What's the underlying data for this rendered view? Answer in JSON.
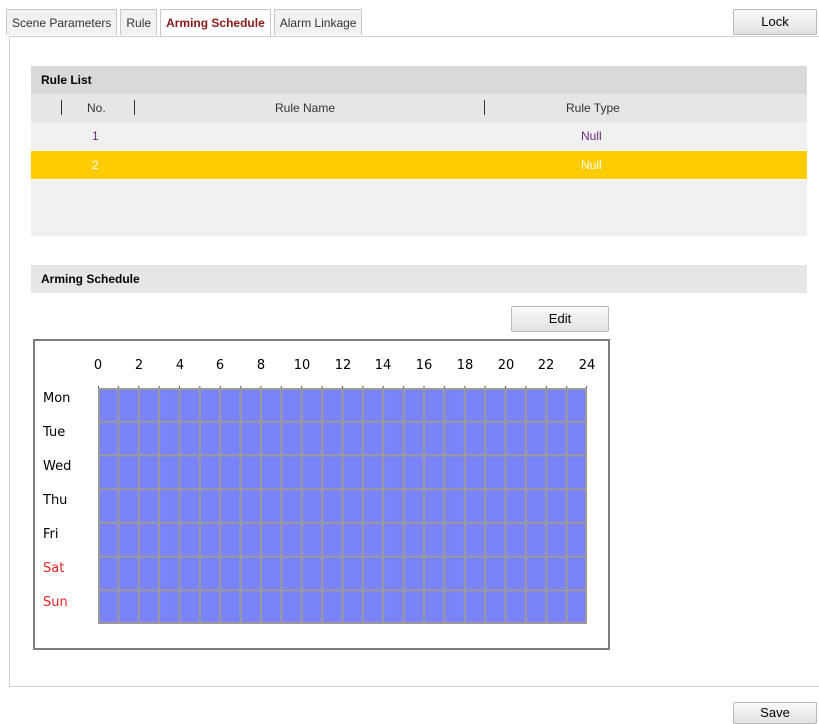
{
  "tabs": [
    {
      "label": "Scene Parameters",
      "active": false
    },
    {
      "label": "Rule",
      "active": false
    },
    {
      "label": "Arming Schedule",
      "active": true
    },
    {
      "label": "Alarm Linkage",
      "active": false
    }
  ],
  "lock_label": "Lock",
  "rule_list": {
    "title": "Rule List",
    "headers": {
      "no": "No.",
      "name": "Rule Name",
      "type": "Rule Type"
    },
    "rows": [
      {
        "no": "1",
        "name": "",
        "type": "Null",
        "selected": false
      },
      {
        "no": "2",
        "name": "",
        "type": "Null",
        "selected": true
      }
    ]
  },
  "arming_schedule": {
    "title": "Arming Schedule",
    "edit_label": "Edit",
    "hours": [
      "0",
      "2",
      "4",
      "6",
      "8",
      "10",
      "12",
      "14",
      "16",
      "18",
      "20",
      "22",
      "24"
    ],
    "days": [
      {
        "label": "Mon",
        "weekend": false
      },
      {
        "label": "Tue",
        "weekend": false
      },
      {
        "label": "Wed",
        "weekend": false
      },
      {
        "label": "Thu",
        "weekend": false
      },
      {
        "label": "Fri",
        "weekend": false
      },
      {
        "label": "Sat",
        "weekend": true
      },
      {
        "label": "Sun",
        "weekend": true
      }
    ],
    "armed_all_day": true
  },
  "save_label": "Save",
  "colors": {
    "schedule_fill": "#7b83f8",
    "grid_line": "#9a9a9a",
    "weekend_text": "#e8221f",
    "selected_row": "#ffcc00",
    "active_tab_text": "#8b1a1a"
  }
}
